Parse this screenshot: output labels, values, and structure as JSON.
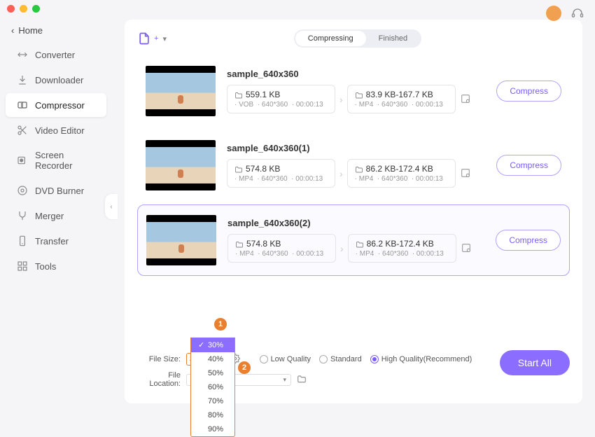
{
  "titlebar": {},
  "header": {
    "avatar": "avatar",
    "support": "headphones"
  },
  "sidebar": {
    "home": "Home",
    "items": [
      {
        "icon": "swap",
        "label": "Converter"
      },
      {
        "icon": "download",
        "label": "Downloader"
      },
      {
        "icon": "compress",
        "label": "Compressor",
        "active": true
      },
      {
        "icon": "scissors",
        "label": "Video Editor"
      },
      {
        "icon": "record",
        "label": "Screen Recorder"
      },
      {
        "icon": "disc",
        "label": "DVD Burner"
      },
      {
        "icon": "merge",
        "label": "Merger"
      },
      {
        "icon": "transfer",
        "label": "Transfer"
      },
      {
        "icon": "grid",
        "label": "Tools"
      }
    ]
  },
  "tabs": {
    "compressing": "Compressing",
    "finished": "Finished"
  },
  "files": [
    {
      "name": "sample_640x360",
      "in_size": "559.1 KB",
      "in_fmt": "VOB",
      "in_res": "640*360",
      "in_dur": "00:00:13",
      "out_size": "83.9 KB-167.7 KB",
      "out_fmt": "MP4",
      "out_res": "640*360",
      "out_dur": "00:00:13"
    },
    {
      "name": "sample_640x360(1)",
      "in_size": "574.8 KB",
      "in_fmt": "MP4",
      "in_res": "640*360",
      "in_dur": "00:00:13",
      "out_size": "86.2 KB-172.4 KB",
      "out_fmt": "MP4",
      "out_res": "640*360",
      "out_dur": "00:00:13"
    },
    {
      "name": "sample_640x360(2)",
      "in_size": "574.8 KB",
      "in_fmt": "MP4",
      "in_res": "640*360",
      "in_dur": "00:00:13",
      "out_size": "86.2 KB-172.4 KB",
      "out_fmt": "MP4",
      "out_res": "640*360",
      "out_dur": "00:00:13",
      "selected": true
    }
  ],
  "compress_label": "Compress",
  "bottom": {
    "size_label": "File Size:",
    "size_value": "30%",
    "location_label": "File Location:",
    "quality": {
      "low": "Low Quality",
      "standard": "Standard",
      "high": "High Quality(Recommend)"
    },
    "start_all": "Start All",
    "size_options": [
      "30%",
      "40%",
      "50%",
      "60%",
      "70%",
      "80%",
      "90%"
    ]
  },
  "badges": {
    "one": "1",
    "two": "2"
  }
}
